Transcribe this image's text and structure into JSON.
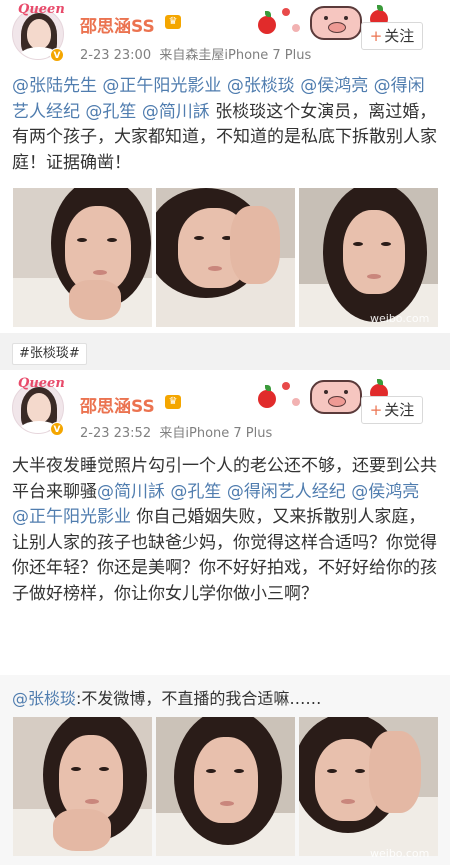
{
  "post1": {
    "avatar_text": "Queen",
    "username": "邵思涵SS",
    "time": "2-23 23:00",
    "source": "来自森圭屋iPhone 7 Plus",
    "follow_label": "关注",
    "follow_plus": "+",
    "text_segments": [
      {
        "t": "@张陆先生",
        "m": true
      },
      {
        "t": " ",
        "m": false
      },
      {
        "t": "@正午阳光影业",
        "m": true
      },
      {
        "t": " ",
        "m": false
      },
      {
        "t": "@张棪琰",
        "m": true
      },
      {
        "t": " ",
        "m": false
      },
      {
        "t": "@侯鸿亮",
        "m": true
      },
      {
        "t": " ",
        "m": false
      },
      {
        "t": "@得闲艺人经纪",
        "m": true
      },
      {
        "t": " ",
        "m": false
      },
      {
        "t": "@孔笙",
        "m": true
      },
      {
        "t": " ",
        "m": false
      },
      {
        "t": "@简川訸",
        "m": true
      },
      {
        "t": " 张棪琰这个女演员，离过婚，有两个孩子，大家都知道，不知道的是私底下拆散别人家庭！证据确凿！",
        "m": false
      }
    ],
    "watermark": "weibo.com"
  },
  "tag": "#张棪琰#",
  "post2": {
    "avatar_text": "Queen",
    "username": "邵思涵SS",
    "time": "2-23 23:52",
    "source": "来自iPhone 7 Plus",
    "follow_label": "关注",
    "follow_plus": "+",
    "text_segments": [
      {
        "t": "大半夜发睡觉照片勾引一个人的老公还不够，还要到公共平台来聊骚",
        "m": false
      },
      {
        "t": "@简川訸",
        "m": true
      },
      {
        "t": " ",
        "m": false
      },
      {
        "t": "@孔笙",
        "m": true
      },
      {
        "t": " ",
        "m": false
      },
      {
        "t": "@得闲艺人经纪",
        "m": true
      },
      {
        "t": " ",
        "m": false
      },
      {
        "t": "@侯鸿亮",
        "m": true
      },
      {
        "t": " ",
        "m": false
      },
      {
        "t": "@正午阳光影业",
        "m": true
      },
      {
        "t": " 你自己婚姻失败，又来拆散别人家庭，让别人家的孩子也缺爸少妈，你觉得这样合适吗？你觉得你还年轻？你还是美啊？你不好好拍戏，不好好给你的孩子做好榜样，你让你女儿学你做小三啊？",
        "m": false
      }
    ],
    "repost_user": "@张棪琰",
    "repost_text": ":不发微博，不直播的我合适嘛……",
    "watermark": "weibo.com"
  },
  "colors": {
    "username": "#eb7350",
    "mention": "#507daf",
    "meta": "#808080"
  }
}
